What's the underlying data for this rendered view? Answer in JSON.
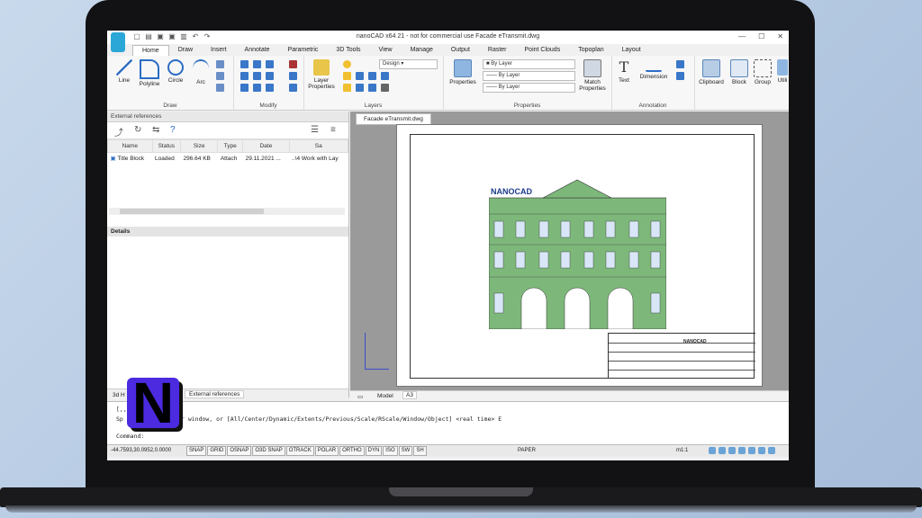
{
  "window": {
    "title": "nanoCAD x64 21 - not for commercial use Facade eTransmit.dwg",
    "controls": [
      "—",
      "☐",
      "✕"
    ]
  },
  "ribbon_tabs": [
    "Home",
    "Draw",
    "Insert",
    "Annotate",
    "Parametric",
    "3D Tools",
    "View",
    "Manage",
    "Output",
    "Raster",
    "Point Clouds",
    "Topoplan",
    "Layout"
  ],
  "ribbon": {
    "draw": {
      "label": "Draw",
      "line": "Line",
      "polyline": "Polyline",
      "circle": "Circle",
      "arc": "Arc"
    },
    "modify": {
      "label": "Modify"
    },
    "layers": {
      "label": "Layers",
      "layer_properties": "Layer Properties",
      "current_layer": "Design"
    },
    "properties": {
      "label": "Properties",
      "properties": "Properties",
      "by_layer_1": "By Layer",
      "by_layer_2": "By Layer",
      "by_layer_3": "By Layer",
      "match": "Match Properties"
    },
    "annotation": {
      "label": "Annotation",
      "text": "Text",
      "dimension": "Dimension"
    },
    "extra": {
      "clipboard": "Clipboard",
      "block": "Block",
      "group": "Group",
      "utilities": "Utili"
    }
  },
  "left_panel": {
    "header": "External references",
    "columns": [
      "Name",
      "Status",
      "Size",
      "Type",
      "Date",
      "Sa"
    ],
    "rows": [
      [
        "Title Block",
        "Loaded",
        "296.64 KB",
        "Attach",
        "29.11.2021 ...",
        "..\\4 Work with Lay"
      ]
    ],
    "details_label": "Details",
    "bottom_tabs": [
      "3d H",
      "External references"
    ]
  },
  "document": {
    "tab": "Facade eTransmit.dwg",
    "model_tabs": [
      "Model",
      "A3"
    ],
    "title_block_text": "NANOCAD",
    "facade_logo": "NANOCAD"
  },
  "command_line": {
    "line1": "[,,",
    "line2_prefix": "Sp",
    "line2": "r window, or [All/Center/Dynamic/Extents/Previous/Scale/RScale/Window/Object] <real time> E",
    "prompt": "Command:"
  },
  "status_bar": {
    "coords": "-44.7593,30.0952,0.0000",
    "toggles": [
      "SNAP",
      "GRID",
      "OSNAP",
      "O3D SNAP",
      "OTRACK",
      "POLAR",
      "ORTHO",
      "DYN",
      "ISO",
      "SW",
      "SH"
    ],
    "space": "PAPER",
    "scale": "m1:1"
  },
  "colors": {
    "facade_green": "#7db87a",
    "accent_blue": "#2aa7d6",
    "logo_purple": "#4b2ae0"
  }
}
